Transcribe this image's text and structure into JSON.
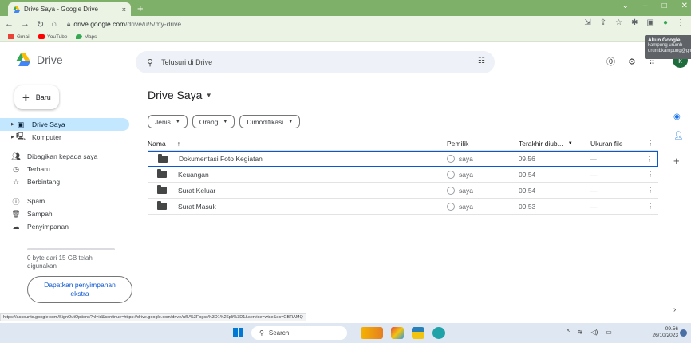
{
  "browser": {
    "tab_title": "Drive Saya - Google Drive",
    "tab_close": "×",
    "new_tab": "+",
    "url_host": "drive.google.com",
    "url_path": "/drive/u/5/my-drive",
    "bookmarks": [
      {
        "label": "Gmail",
        "color": "#ea4335"
      },
      {
        "label": "YouTube",
        "color": "#ff0000"
      },
      {
        "label": "Maps",
        "color": "#34a853"
      }
    ],
    "status_url": "https://accounts.google.com/SignOutOptions?hl=id&continue=https://drive.google.com/drive/u/5/%3Fogss%3D1%26pli%3D1&service=wise&ec=GBRAMQ"
  },
  "drive": {
    "app_name": "Drive",
    "search_placeholder": "Telusuri di Drive",
    "avatar_letter": "k",
    "tooltip": {
      "title": "Akun Google",
      "name": "kampung urumb",
      "email": "urumbkampung@gmail.com"
    },
    "new_button": "Baru",
    "nav": [
      {
        "label": "Drive Saya",
        "icon": "drive-icon",
        "active": true
      },
      {
        "label": "Komputer",
        "icon": "computer-icon"
      },
      {
        "label": "Dibagikan kepada saya",
        "icon": "shared-icon"
      },
      {
        "label": "Terbaru",
        "icon": "clock-icon"
      },
      {
        "label": "Berbintang",
        "icon": "star-icon"
      },
      {
        "label": "Spam",
        "icon": "spam-icon"
      },
      {
        "label": "Sampah",
        "icon": "trash-icon"
      },
      {
        "label": "Penyimpanan",
        "icon": "cloud-icon"
      }
    ],
    "storage_text": "0 byte dari 15 GB telah digunakan",
    "get_storage_button": "Dapatkan penyimpanan ekstra",
    "page_title": "Drive Saya",
    "filters": [
      "Jenis",
      "Orang",
      "Dimodifikasi"
    ],
    "columns": {
      "name": "Nama",
      "owner": "Pemilik",
      "modified": "Terakhir diub...",
      "size": "Ukuran file"
    },
    "rows": [
      {
        "name": "Dokumentasi Foto Kegiatan",
        "owner": "saya",
        "modified": "09.56",
        "size": "—"
      },
      {
        "name": "Keuangan",
        "owner": "saya",
        "modified": "09.54",
        "size": "—"
      },
      {
        "name": "Surat Keluar",
        "owner": "saya",
        "modified": "09.54",
        "size": "—"
      },
      {
        "name": "Surat Masuk",
        "owner": "saya",
        "modified": "09.53",
        "size": "—"
      }
    ]
  },
  "taskbar": {
    "search_label": "Search",
    "time": "09.56",
    "date": "26/10/2023"
  }
}
